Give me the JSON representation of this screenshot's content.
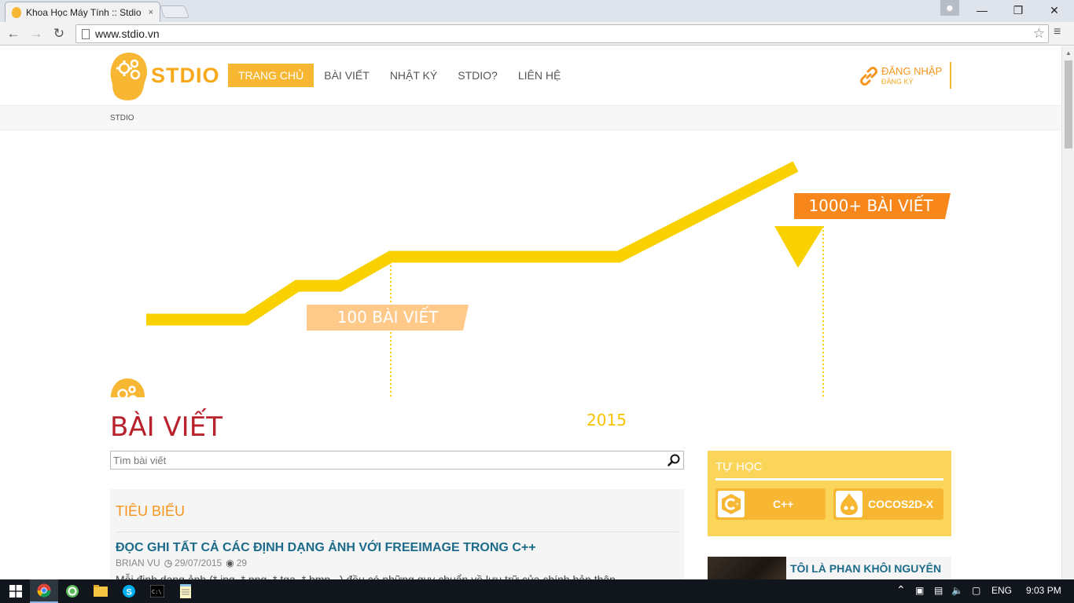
{
  "browser": {
    "tab_title": "Khoa Học Máy Tính :: Stdio",
    "tab_close": "×",
    "url": "www.stdio.vn",
    "window_controls": {
      "minimize": "—",
      "maximize": "❐",
      "close": "✕"
    }
  },
  "site": {
    "logo_text": "STDIO",
    "nav": [
      {
        "label": "TRANG CHỦ",
        "active": true
      },
      {
        "label": "BÀI VIẾT",
        "active": false
      },
      {
        "label": "NHẬT KÝ",
        "active": false
      },
      {
        "label": "STDIO?",
        "active": false
      },
      {
        "label": "LIÊN HỆ",
        "active": false
      }
    ],
    "login": "ĐĂNG NHẬP",
    "register": "ĐĂNG KÝ",
    "breadcrumb": "STDIO",
    "accent_color": "#f7b733"
  },
  "hero": {
    "milestone_1": "100 BÀI VIẾT",
    "milestone_2": "1000+ BÀI VIẾT",
    "year": "2015"
  },
  "posts": {
    "section_title": "BÀI VIẾT",
    "search_placeholder": "Tìm bài viết",
    "featured_heading": "TIÊU BIỂU",
    "featured_post": {
      "title": "ĐỌC GHI TẤT CẢ CÁC ĐỊNH DẠNG ẢNH VỚI FREEIMAGE TRONG C++",
      "author": "BRIAN VU",
      "date": "29/07/2015",
      "views": "29",
      "excerpt": "Mỗi định dạng ảnh (*.jpg, *.png, *.tga, *.bmp...) đều có những quy chuẩn về lưu trữ của chính bản thân"
    }
  },
  "sidebar": {
    "tuhoc_title": "TỰ HỌC",
    "courses": [
      {
        "label": "C++",
        "icon": "cpp-icon"
      },
      {
        "label": "COCOS2D-X",
        "icon": "cocos-icon"
      }
    ],
    "profile_name": "TÔI LÀ PHAN KHÔI NGUYÊN"
  },
  "taskbar": {
    "lang": "ENG",
    "time": "9:03 PM"
  }
}
